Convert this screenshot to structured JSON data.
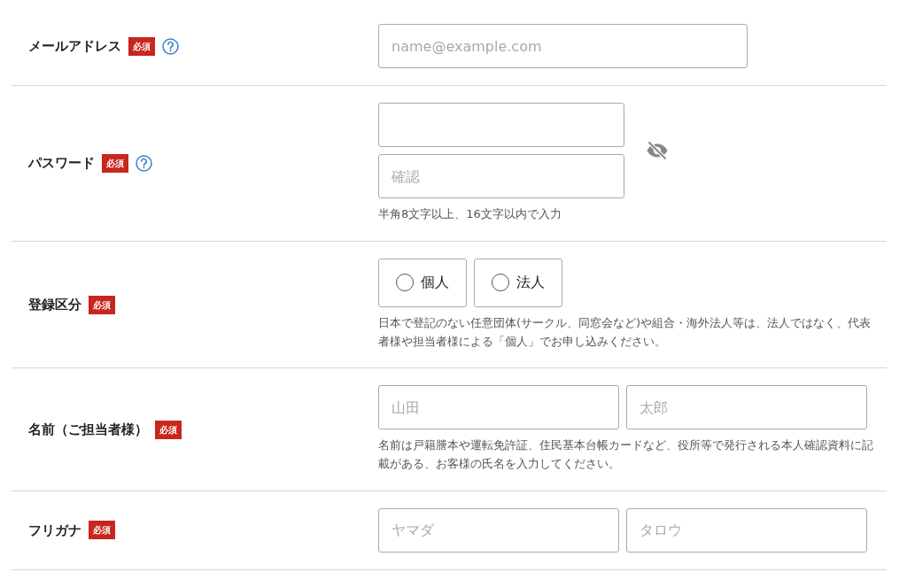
{
  "rows": [
    {
      "kind": "email",
      "label": "メールアドレス",
      "badge": "必須",
      "help": true,
      "fields": [
        {
          "placeholder": "name@example.com"
        }
      ]
    },
    {
      "kind": "password",
      "label": "パスワード",
      "badge": "必須",
      "help": true,
      "fields": [
        {
          "kind": "password"
        },
        {
          "kind": "password",
          "placeholder": "確認"
        }
      ],
      "note": "半角8文字以上、16文字以内で入力"
    },
    {
      "kind": "choice",
      "label": "登録区分",
      "badge": "必須",
      "help": false,
      "options": [
        {
          "label": "個人",
          "selected": false
        },
        {
          "label": "法人",
          "selected": false
        }
      ],
      "note": "日本で登記のない任意団体(サークル、同窓会など)や組合・海外法人等は、法人ではなく、代表者様や担当者様による「個人」でお申し込みください。"
    },
    {
      "kind": "pair",
      "label": "名前（ご担当者様）",
      "badge": "必須",
      "help": false,
      "fields": [
        {
          "placeholder": "山田"
        },
        {
          "placeholder": "太郎"
        }
      ],
      "note": "名前は戸籍謄本や運転免許証、住民基本台帳カードなど、役所等で発行される本人確認資料に記載がある、お客様の氏名を入力してください。"
    },
    {
      "kind": "pair",
      "label": "フリガナ",
      "badge": "必須",
      "help": false,
      "fields": [
        {
          "placeholder": "ヤマダ"
        },
        {
          "placeholder": "タロウ"
        }
      ]
    }
  ]
}
